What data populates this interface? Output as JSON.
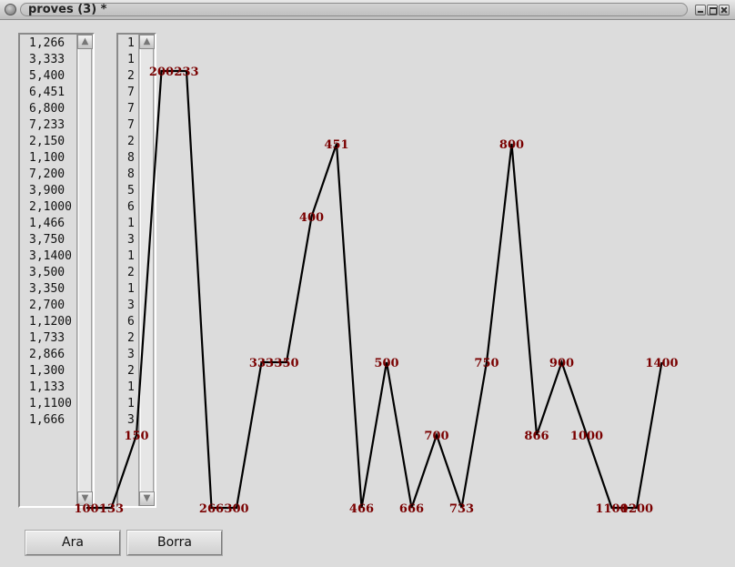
{
  "window": {
    "title": "proves (3) *"
  },
  "list_left": {
    "items": [
      "1,266",
      "3,333",
      "5,400",
      "6,451",
      "6,800",
      "7,233",
      "2,150",
      "1,100",
      "7,200",
      "3,900",
      "2,1000",
      "1,466",
      "3,750",
      "3,1400",
      "3,500",
      "3,350",
      "2,700",
      "1,1200",
      "1,733",
      "2,866",
      "1,300",
      "1,133",
      "1,1100",
      "1,666"
    ]
  },
  "list_right": {
    "items": [
      "1",
      "1",
      "2",
      "7",
      "7",
      "7",
      "2",
      "8",
      "8",
      "5",
      "6",
      "1",
      "3",
      "1",
      "2",
      "1",
      "3",
      "6",
      "2",
      "3",
      "2",
      "1",
      "1",
      "3"
    ]
  },
  "buttons": {
    "ara": "Ara",
    "borra": "Borra"
  },
  "chart_data": {
    "type": "line",
    "series": [
      {
        "points": [
          {
            "label": "100",
            "y": 1
          },
          {
            "label": "133",
            "y": 1
          },
          {
            "label": "150",
            "y": 2
          },
          {
            "label": "200",
            "y": 7
          },
          {
            "label": "233",
            "y": 7
          },
          {
            "label": "266",
            "y": 1
          },
          {
            "label": "300",
            "y": 1
          },
          {
            "label": "333",
            "y": 3
          },
          {
            "label": "350",
            "y": 3
          },
          {
            "label": "400",
            "y": 5
          },
          {
            "label": "451",
            "y": 6
          },
          {
            "label": "466",
            "y": 1
          },
          {
            "label": "500",
            "y": 3
          },
          {
            "label": "666",
            "y": 1
          },
          {
            "label": "700",
            "y": 2
          },
          {
            "label": "733",
            "y": 1
          },
          {
            "label": "750",
            "y": 3
          },
          {
            "label": "800",
            "y": 6
          },
          {
            "label": "866",
            "y": 2
          },
          {
            "label": "900",
            "y": 3
          },
          {
            "label": "1000",
            "y": 2
          },
          {
            "label": "1100",
            "y": 1
          },
          {
            "label": "1200",
            "y": 1
          },
          {
            "label": "1400",
            "y": 3
          }
        ]
      }
    ],
    "colors": {
      "line": "#000000",
      "labels": "#7a0000"
    }
  }
}
